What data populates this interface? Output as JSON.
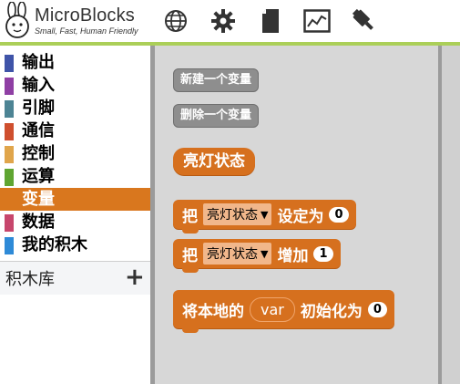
{
  "app": {
    "brand": "MicroBlocks",
    "tagline": "Small, Fast, Human Friendly",
    "toolbar_icons": [
      "globe-icon",
      "gear-icon",
      "file-icon",
      "graph-icon",
      "usb-icon"
    ]
  },
  "categories": [
    {
      "label": "输出",
      "color": "#3f54a8"
    },
    {
      "label": "输入",
      "color": "#8f3fa4"
    },
    {
      "label": "引脚",
      "color": "#4d8494"
    },
    {
      "label": "通信",
      "color": "#cf4f2e"
    },
    {
      "label": "控制",
      "color": "#e0a54b"
    },
    {
      "label": "运算",
      "color": "#5fa531"
    },
    {
      "label": "变量",
      "color": "#d9771e",
      "selected": true
    },
    {
      "label": "数据",
      "color": "#c7466c"
    },
    {
      "label": "我的积木",
      "color": "#2e8ad7"
    }
  ],
  "library": {
    "label": "积木库",
    "add_symbol": "+"
  },
  "blocks": {
    "new_var_button": "新建一个变量",
    "delete_var_button": "删除一个变量",
    "variable_name": "亮灯状态",
    "set_block": {
      "prefix": "把",
      "var": "亮灯状态",
      "dropdown_arrow": "▼",
      "action": "设定为",
      "value": "0"
    },
    "change_block": {
      "prefix": "把",
      "var": "亮灯状态",
      "dropdown_arrow": "▼",
      "action": "增加",
      "value": "1"
    },
    "local_block": {
      "prefix": "将本地的",
      "var": "var",
      "action": "初始化为",
      "value": "0"
    }
  },
  "colors": {
    "accent_line": "#abcf58",
    "variables": "#d6701e",
    "selected_category": "#d9771e"
  }
}
